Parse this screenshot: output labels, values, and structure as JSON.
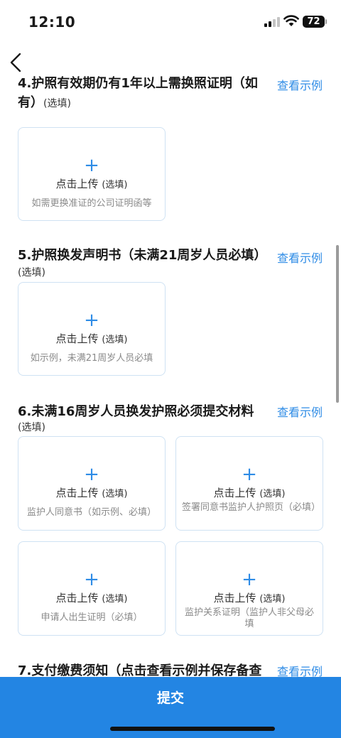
{
  "status_bar": {
    "time": "12:10",
    "battery": "72"
  },
  "sections": [
    {
      "title_line1": "4.护照有效期仍有1年以上需换照证明（如",
      "title_line2": "有）",
      "optional": "(选填)",
      "example_link": "查看示例",
      "uploads": [
        {
          "plus": "+",
          "label": "点击上传",
          "label_sub": "(选填)",
          "hint": "如需更换准证的公司证明函等"
        }
      ]
    },
    {
      "title_line1": "5.护照换发声明书（未满21周岁人员必填）",
      "optional": "(选填)",
      "example_link": "查看示例",
      "uploads": [
        {
          "plus": "+",
          "label": "点击上传",
          "label_sub": "(选填)",
          "hint": "如示例，未满21周岁人员必填"
        }
      ]
    },
    {
      "title_line1": "6.未满16周岁人员换发护照必须提交材料",
      "optional": "(选填)",
      "example_link": "查看示例",
      "uploads": [
        {
          "plus": "+",
          "label": "点击上传",
          "label_sub": "(选填)",
          "hint": "监护人同意书（如示例、必填）"
        },
        {
          "plus": "+",
          "label": "点击上传",
          "label_sub": "(选填)",
          "hint": "签署同意书监护人护照页（必填）"
        },
        {
          "plus": "+",
          "label": "点击上传",
          "label_sub": "(选填)",
          "hint": "申请人出生证明（必填）"
        },
        {
          "plus": "+",
          "label": "点击上传",
          "label_sub": "(选填)",
          "hint": "监护关系证明（监护人非父母必填"
        }
      ]
    },
    {
      "title_line1": "7.支付缴费须知（点击查看示例并保存备查",
      "example_link": "查看示例"
    }
  ],
  "submit": {
    "label": "提交"
  }
}
